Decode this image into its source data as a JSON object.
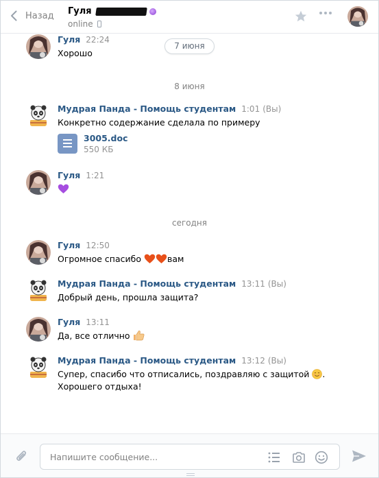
{
  "header": {
    "back_label": "Назад",
    "peer_name": "Гуля",
    "peer_status": "online"
  },
  "date_pill": "7 июня",
  "messages": [
    {
      "author": "Гуля",
      "time": "22:24",
      "text": "Хорошо"
    },
    {
      "date": "8 июня"
    },
    {
      "author": "Мудрая Панда - Помощь студентам",
      "time": "1:01",
      "you": "(Вы)",
      "text": "Конкретно содержание сделала по примеру",
      "attachment": {
        "name": "3005.doc",
        "size": "550 КБ"
      }
    },
    {
      "author": "Гуля",
      "time": "1:21",
      "emoji": "purple-heart"
    },
    {
      "date": "сегодня"
    },
    {
      "author": "Гуля",
      "time": "12:50",
      "text_before": "Огромное спасибо",
      "text_after": "вам"
    },
    {
      "author": "Мудрая Панда - Помощь студентам",
      "time": "13:11",
      "you": "(Вы)",
      "text": "Добрый день, прошла защита?"
    },
    {
      "author": "Гуля",
      "time": "13:11",
      "text": "Да, все отлично"
    },
    {
      "author": "Мудрая Панда - Помощь студентам",
      "time": "13:12",
      "you": "(Вы)",
      "text_line1": "Супер, спасибо что отписались, поздравляю с защитой",
      "text_line1_end": ".",
      "text_line2": "Хорошего отдыха!"
    }
  ],
  "composer": {
    "placeholder": "Напишите сообщение..."
  },
  "icons": [
    "chevron-left-icon",
    "phone-icon",
    "star-icon",
    "more-icon",
    "paperclip-icon",
    "list-icon",
    "camera-icon",
    "smile-icon",
    "send-icon",
    "document-icon"
  ],
  "colors": {
    "link": "#2a5885",
    "muted": "#828282",
    "doc": "#7896c4",
    "heart": "#e8501a"
  }
}
